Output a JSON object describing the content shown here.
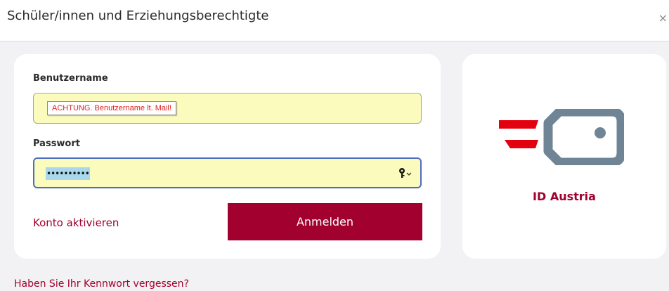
{
  "header": {
    "title": "Schüler/innen und Erziehungsberechtigte",
    "close_label": "×"
  },
  "login": {
    "username_label": "Benutzername",
    "username_tooltip": "ACHTUNG. Benutzername lt. Mail!",
    "password_label": "Passwort",
    "password_value": "••••••••••",
    "activate_label": "Konto aktivieren",
    "login_button": "Anmelden"
  },
  "id_austria": {
    "label": "ID Austria"
  },
  "footer": {
    "forgot_label": "Haben Sie Ihr Kennwort vergessen?"
  },
  "icons": {
    "password_manager": "key-icon",
    "logo": "id-austria-logo"
  },
  "colors": {
    "accent": "#a2002e",
    "field_background": "#fbfbbd",
    "focus_border": "#4f6dbd"
  }
}
